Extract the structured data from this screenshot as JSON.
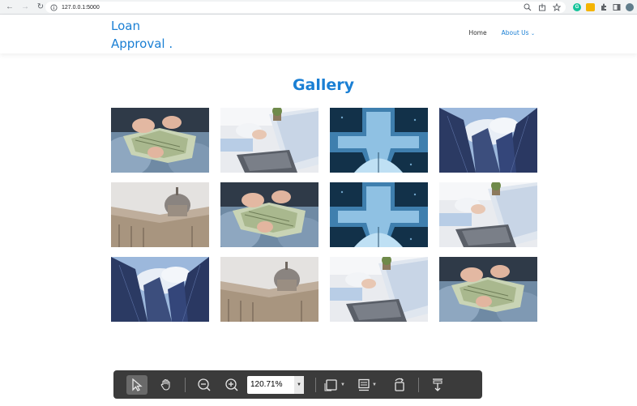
{
  "browser": {
    "url": "127.0.0.1:5000"
  },
  "site": {
    "logo_line1": "Loan",
    "logo_line2": "Approval .",
    "nav": [
      {
        "label": "Home",
        "active": false
      },
      {
        "label": "About Us",
        "active": true
      }
    ]
  },
  "gallery": {
    "title": "Gallery",
    "images": [
      {
        "subject": "money-hands"
      },
      {
        "subject": "laptop-desk"
      },
      {
        "subject": "umbrella-reflection"
      },
      {
        "subject": "skyscrapers"
      },
      {
        "subject": "dome-building"
      },
      {
        "subject": "money-hands"
      },
      {
        "subject": "umbrella-reflection"
      },
      {
        "subject": "laptop-desk"
      },
      {
        "subject": "skyscrapers"
      },
      {
        "subject": "dome-building"
      },
      {
        "subject": "laptop-desk"
      },
      {
        "subject": "money-hands"
      }
    ]
  },
  "pdf_toolbar": {
    "zoom": "120.71%"
  },
  "colors": {
    "accent": "#1a7fd4",
    "toolbar_bg": "#3b3b3b"
  }
}
